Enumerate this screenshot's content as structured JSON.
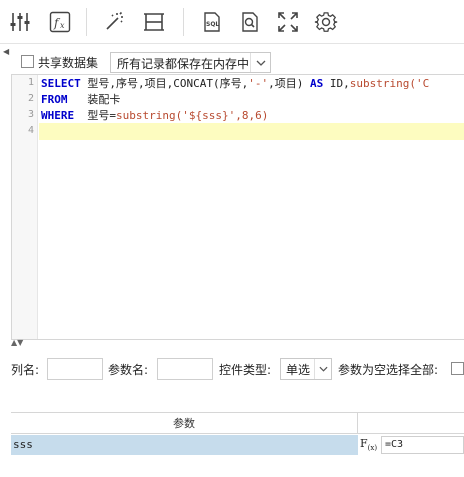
{
  "toolbar": {
    "icons": [
      "sliders-icon",
      "formula-fx-icon",
      "magic-wand-icon",
      "column-adjust-icon",
      "sql-icon",
      "search-document-icon",
      "fullscreen-icon",
      "gear-icon"
    ]
  },
  "options": {
    "shared_dataset_label": "共享数据集",
    "shared_dataset_checked": false,
    "storage_mode_value": "所有记录都保存在内存中"
  },
  "editor": {
    "line_numbers": [
      "1",
      "2",
      "3",
      "4"
    ],
    "line1": {
      "kw1": "SELECT",
      "cols": " 型号,序号,项目,CONCAT(序号,",
      "str1": "'-'",
      "rest": ",项目) ",
      "kw2": "AS",
      "alias": " ID,",
      "fn": "substring(",
      "str2": "'C"
    },
    "line2": {
      "kw": "FROM",
      "table": "   装配卡"
    },
    "line3": {
      "kw": "WHERE",
      "col": "  型号=",
      "fn": "substring(",
      "str": "'${sss}'",
      "rest": ",8,6)"
    }
  },
  "params_form": {
    "column_name_label": "列名:",
    "column_name_value": "",
    "param_name_label": "参数名:",
    "param_name_value": "",
    "control_type_label": "控件类型:",
    "control_type_value": "单选",
    "select_all_when_empty_label": "参数为空选择全部:",
    "select_all_when_empty_checked": false
  },
  "param_table": {
    "header": "参数",
    "rows": [
      {
        "name": "sss",
        "fx_label": "F",
        "fx_sub": "(x)",
        "value": "=C3"
      }
    ]
  }
}
